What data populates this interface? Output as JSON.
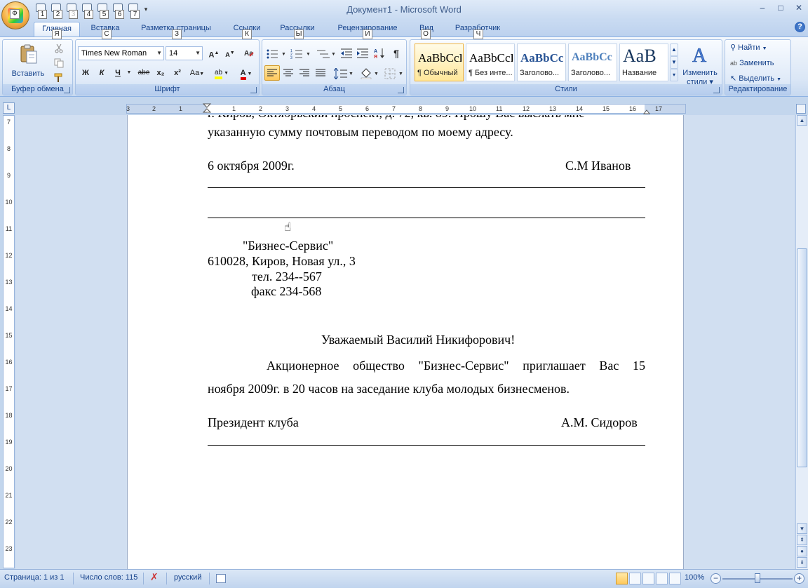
{
  "window": {
    "title": "Документ1 - Microsoft Word",
    "minimize": "–",
    "maximize": "□",
    "close": "✕"
  },
  "office_button": {
    "key": "Ф",
    "logo": "W"
  },
  "quick_access": {
    "keys": [
      "1",
      "2",
      "3",
      "4",
      "5",
      "6",
      "7"
    ],
    "dropdown": "▾"
  },
  "tabs": [
    {
      "label": "Главная",
      "key": "Я",
      "active": true
    },
    {
      "label": "Вставка",
      "key": "С"
    },
    {
      "label": "Разметка страницы",
      "key": "З"
    },
    {
      "label": "Ссылки",
      "key": "К"
    },
    {
      "label": "Рассылки",
      "key": "Ы"
    },
    {
      "label": "Рецензирование",
      "key": "И"
    },
    {
      "label": "Вид",
      "key": "О"
    },
    {
      "label": "Разработчик",
      "key": "Ч"
    }
  ],
  "help": "?",
  "ribbon": {
    "clipboard": {
      "label": "Буфер обмена",
      "paste": "Вставить"
    },
    "font": {
      "label": "Шрифт",
      "font_name": "Times New Roman",
      "font_size": "14",
      "grow": "A",
      "shrink": "A",
      "bold": "Ж",
      "italic": "К",
      "underline": "Ч",
      "strike": "abe",
      "subscript": "x₂",
      "superscript": "x²",
      "case": "Aa",
      "font_color": "A",
      "highlight": "ab"
    },
    "paragraph": {
      "label": "Абзац",
      "pilcrow": "¶"
    },
    "styles": {
      "label": "Стили",
      "items": [
        {
          "sample": "AaBbCcDc",
          "name": "¶ Обычный",
          "selected": true
        },
        {
          "sample": "AaBbCcDc",
          "name": "¶ Без инте..."
        },
        {
          "sample": "AaBbCc",
          "name": "Заголово..."
        },
        {
          "sample": "AaBbCc",
          "name": "Заголово..."
        },
        {
          "sample": "AaB",
          "name": "Название"
        }
      ],
      "change_styles_1": "Изменить",
      "change_styles_2": "стили"
    },
    "editing": {
      "label": "Редактирование",
      "find": "Найти",
      "replace": "Заменить",
      "select": "Выделить"
    }
  },
  "ruler": {
    "corner": "L",
    "top_numbers": [
      "3",
      "2",
      "1",
      "1",
      "2",
      "3",
      "4",
      "5",
      "6",
      "7",
      "8",
      "9",
      "10",
      "11",
      "12",
      "13",
      "14",
      "15",
      "16",
      "17"
    ],
    "left_numbers": [
      "7",
      "8",
      "9",
      "10",
      "11",
      "12",
      "13",
      "14",
      "15",
      "16",
      "17",
      "18",
      "19",
      "20",
      "21",
      "22",
      "23"
    ]
  },
  "document": {
    "line1": "г. Киров, Октябрьский проспект, д. 72, кв. 89. Прошу Вас выслать мне",
    "line2": "указанную сумму почтовым переводом по моему адресу.",
    "date": "6 октября 2009г.",
    "signer1": "С.М Иванов",
    "company": "\"Бизнес-Сервис\"",
    "address": "610028, Киров, Новая ул., 3",
    "phone": "тел. 234--567",
    "fax": "факс 234-568",
    "greeting": "Уважаемый Василий Никифорович!",
    "body1": "Акционерное общество \"Бизнес-Сервис\" приглашает Вас 15",
    "body2": "ноября 2009г. в 20 часов на заседание клуба молодых бизнесменов.",
    "position": "Президент клуба",
    "signer2": "А.М. Сидоров"
  },
  "status": {
    "page": "Страница: 1 из 1",
    "words": "Число слов: 115",
    "language": "русский",
    "zoom": "100%",
    "zoom_level": 0.5
  }
}
